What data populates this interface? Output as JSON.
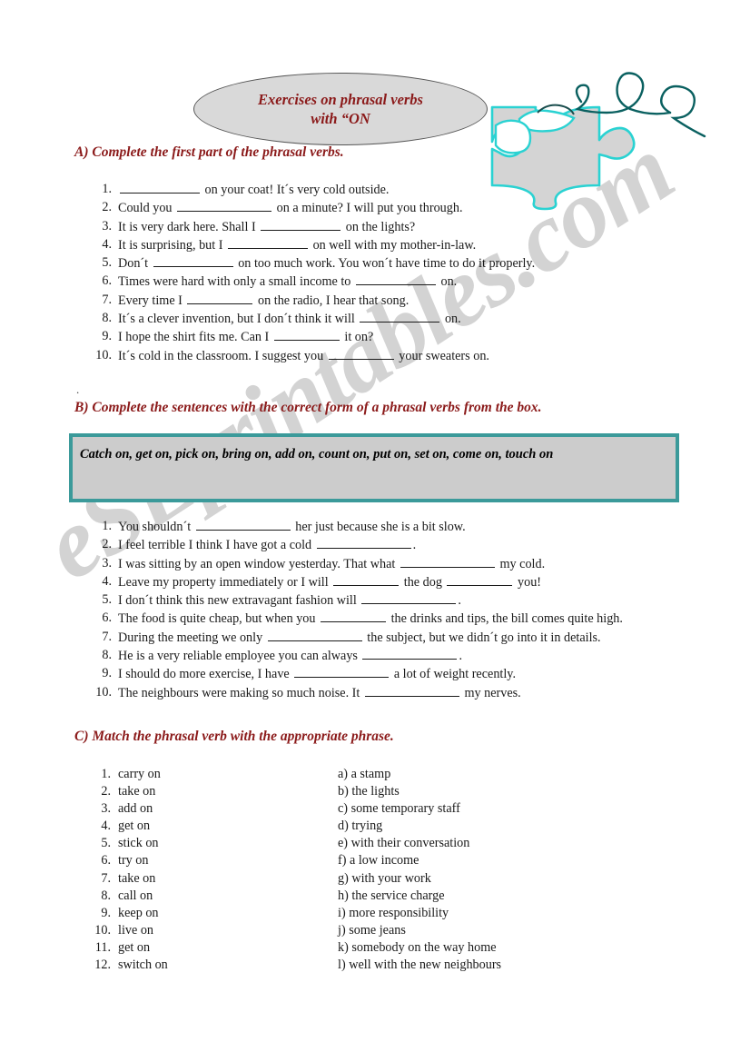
{
  "document": {
    "title_line1": "Exercises on phrasal verbs",
    "title_line2": "with “ON",
    "watermark": "eSLprintables.com",
    "stray_mark": "."
  },
  "sections": {
    "a": {
      "heading": "A) Complete the first part of the phrasal verbs.",
      "items": [
        {
          "num": "1.",
          "parts": [
            {
              "t": "blank",
              "w": "b-lg"
            },
            {
              "t": "text",
              "v": " on your coat! It´s very cold outside."
            }
          ]
        },
        {
          "num": "2.",
          "parts": [
            {
              "t": "text",
              "v": "Could you "
            },
            {
              "t": "blank",
              "w": "b-xl"
            },
            {
              "t": "text",
              "v": " on a minute? I will put you through."
            }
          ]
        },
        {
          "num": "3.",
          "parts": [
            {
              "t": "text",
              "v": "It is very dark here. Shall I "
            },
            {
              "t": "blank",
              "w": "b-lg"
            },
            {
              "t": "text",
              "v": " on the lights?"
            }
          ]
        },
        {
          "num": "4.",
          "parts": [
            {
              "t": "text",
              "v": "It is surprising, but I "
            },
            {
              "t": "blank",
              "w": "b-lg"
            },
            {
              "t": "text",
              "v": " on well with my mother-in-law."
            }
          ]
        },
        {
          "num": "5.",
          "parts": [
            {
              "t": "text",
              "v": "Don´t "
            },
            {
              "t": "blank",
              "w": "b-lg"
            },
            {
              "t": "text",
              "v": " on too much work. You won´t have time to do it properly."
            }
          ]
        },
        {
          "num": "6.",
          "parts": [
            {
              "t": "text",
              "v": "Times were hard with only a small income to "
            },
            {
              "t": "blank",
              "w": "b-lg"
            },
            {
              "t": "text",
              "v": " on."
            }
          ]
        },
        {
          "num": "7.",
          "parts": [
            {
              "t": "text",
              "v": "Every time I "
            },
            {
              "t": "blank",
              "w": "b-md"
            },
            {
              "t": "text",
              "v": " on the radio, I hear that song."
            }
          ]
        },
        {
          "num": "8.",
          "parts": [
            {
              "t": "text",
              "v": "It´s a clever invention, but I don´t think it will "
            },
            {
              "t": "blank",
              "w": "b-lg"
            },
            {
              "t": "text",
              "v": " on."
            }
          ]
        },
        {
          "num": "9.",
          "parts": [
            {
              "t": "text",
              "v": "I hope the shirt fits me. Can I "
            },
            {
              "t": "blank",
              "w": "b-md"
            },
            {
              "t": "text",
              "v": " it on?"
            }
          ]
        },
        {
          "num": "10.",
          "parts": [
            {
              "t": "text",
              "v": "It´s cold in the classroom. I suggest you "
            },
            {
              "t": "blank",
              "w": "b-md"
            },
            {
              "t": "text",
              "v": " your sweaters on."
            }
          ]
        }
      ]
    },
    "b": {
      "heading": "B) Complete the sentences with the correct form of a phrasal verbs from the box.",
      "word_box": "Catch on, get on, pick on, bring on, add on,  count on, put on, set on, come on, touch on",
      "items": [
        {
          "num": "1.",
          "parts": [
            {
              "t": "text",
              "v": "You shouldn´t "
            },
            {
              "t": "blank",
              "w": "b-xl"
            },
            {
              "t": "text",
              "v": " her just because she is a bit slow."
            }
          ]
        },
        {
          "num": "2.",
          "parts": [
            {
              "t": "text",
              "v": "I feel terrible I think I have got a cold "
            },
            {
              "t": "blank",
              "w": "b-xl"
            },
            {
              "t": "text",
              "v": "."
            }
          ]
        },
        {
          "num": "3.",
          "parts": [
            {
              "t": "text",
              "v": "I was sitting by an open window yesterday. That what "
            },
            {
              "t": "blank",
              "w": "b-xl"
            },
            {
              "t": "text",
              "v": " my cold."
            }
          ]
        },
        {
          "num": "4.",
          "parts": [
            {
              "t": "text",
              "v": "Leave my property immediately or I will "
            },
            {
              "t": "blank",
              "w": "b-md"
            },
            {
              "t": "text",
              "v": " the dog "
            },
            {
              "t": "blank",
              "w": "b-md"
            },
            {
              "t": "text",
              "v": " you!"
            }
          ]
        },
        {
          "num": "5.",
          "parts": [
            {
              "t": "text",
              "v": "I don´t think this new extravagant fashion will "
            },
            {
              "t": "blank",
              "w": "b-xl"
            },
            {
              "t": "text",
              "v": "."
            }
          ]
        },
        {
          "num": "6.",
          "parts": [
            {
              "t": "text",
              "v": "The food is quite cheap, but when you "
            },
            {
              "t": "blank",
              "w": "b-md"
            },
            {
              "t": "text",
              "v": " the drinks and tips, the bill comes quite high."
            }
          ]
        },
        {
          "num": "7.",
          "parts": [
            {
              "t": "text",
              "v": "During the meeting we only "
            },
            {
              "t": "blank",
              "w": "b-xl"
            },
            {
              "t": "text",
              "v": " the subject, but we didn´t go into it in details."
            }
          ]
        },
        {
          "num": "8.",
          "parts": [
            {
              "t": "text",
              "v": "He is a very reliable employee you can always "
            },
            {
              "t": "blank",
              "w": "b-xl"
            },
            {
              "t": "text",
              "v": "."
            }
          ]
        },
        {
          "num": "9.",
          "parts": [
            {
              "t": "text",
              "v": "I should do more exercise, I have "
            },
            {
              "t": "blank",
              "w": "b-xl"
            },
            {
              "t": "text",
              "v": " a lot of weight recently."
            }
          ]
        },
        {
          "num": "10.",
          "parts": [
            {
              "t": "text",
              "v": "The neighbours were making so much noise. It "
            },
            {
              "t": "blank",
              "w": "b-xl"
            },
            {
              "t": "text",
              "v": " my nerves."
            }
          ]
        }
      ]
    },
    "c": {
      "heading": "C) Match the phrasal verb with the appropriate phrase.",
      "rows": [
        {
          "num": "1.",
          "verb": "carry on",
          "phrase": "a) a stamp"
        },
        {
          "num": "2.",
          "verb": "take on",
          "phrase": "b) the lights"
        },
        {
          "num": "3.",
          "verb": "add on",
          "phrase": "c) some temporary staff"
        },
        {
          "num": "4.",
          "verb": "get on",
          "phrase": "d) trying"
        },
        {
          "num": "5.",
          "verb": "stick on",
          "phrase": "e) with their conversation"
        },
        {
          "num": "6.",
          "verb": "try on",
          "phrase": "f) a low income"
        },
        {
          "num": "7.",
          "verb": "take on",
          "phrase": "g) with your work"
        },
        {
          "num": "8.",
          "verb": "call on",
          "phrase": "h) the service charge"
        },
        {
          "num": "9.",
          "verb": "keep on",
          "phrase": "i) more responsibility"
        },
        {
          "num": "10.",
          "verb": "live on",
          "phrase": "j) some jeans"
        },
        {
          "num": "11.",
          "verb": "get on",
          "phrase": "k) somebody on the way home"
        },
        {
          "num": "12.",
          "verb": "switch on",
          "phrase": "l) well with the new neighbours"
        }
      ]
    }
  },
  "colors": {
    "heading": "#8b1a1a",
    "box_border": "#3b9a9a",
    "box_fill": "#cccccc",
    "puzzle_outline": "#2ad2d2",
    "puzzle_fill": "#d4d4d4",
    "squiggle": "#0a6060"
  }
}
